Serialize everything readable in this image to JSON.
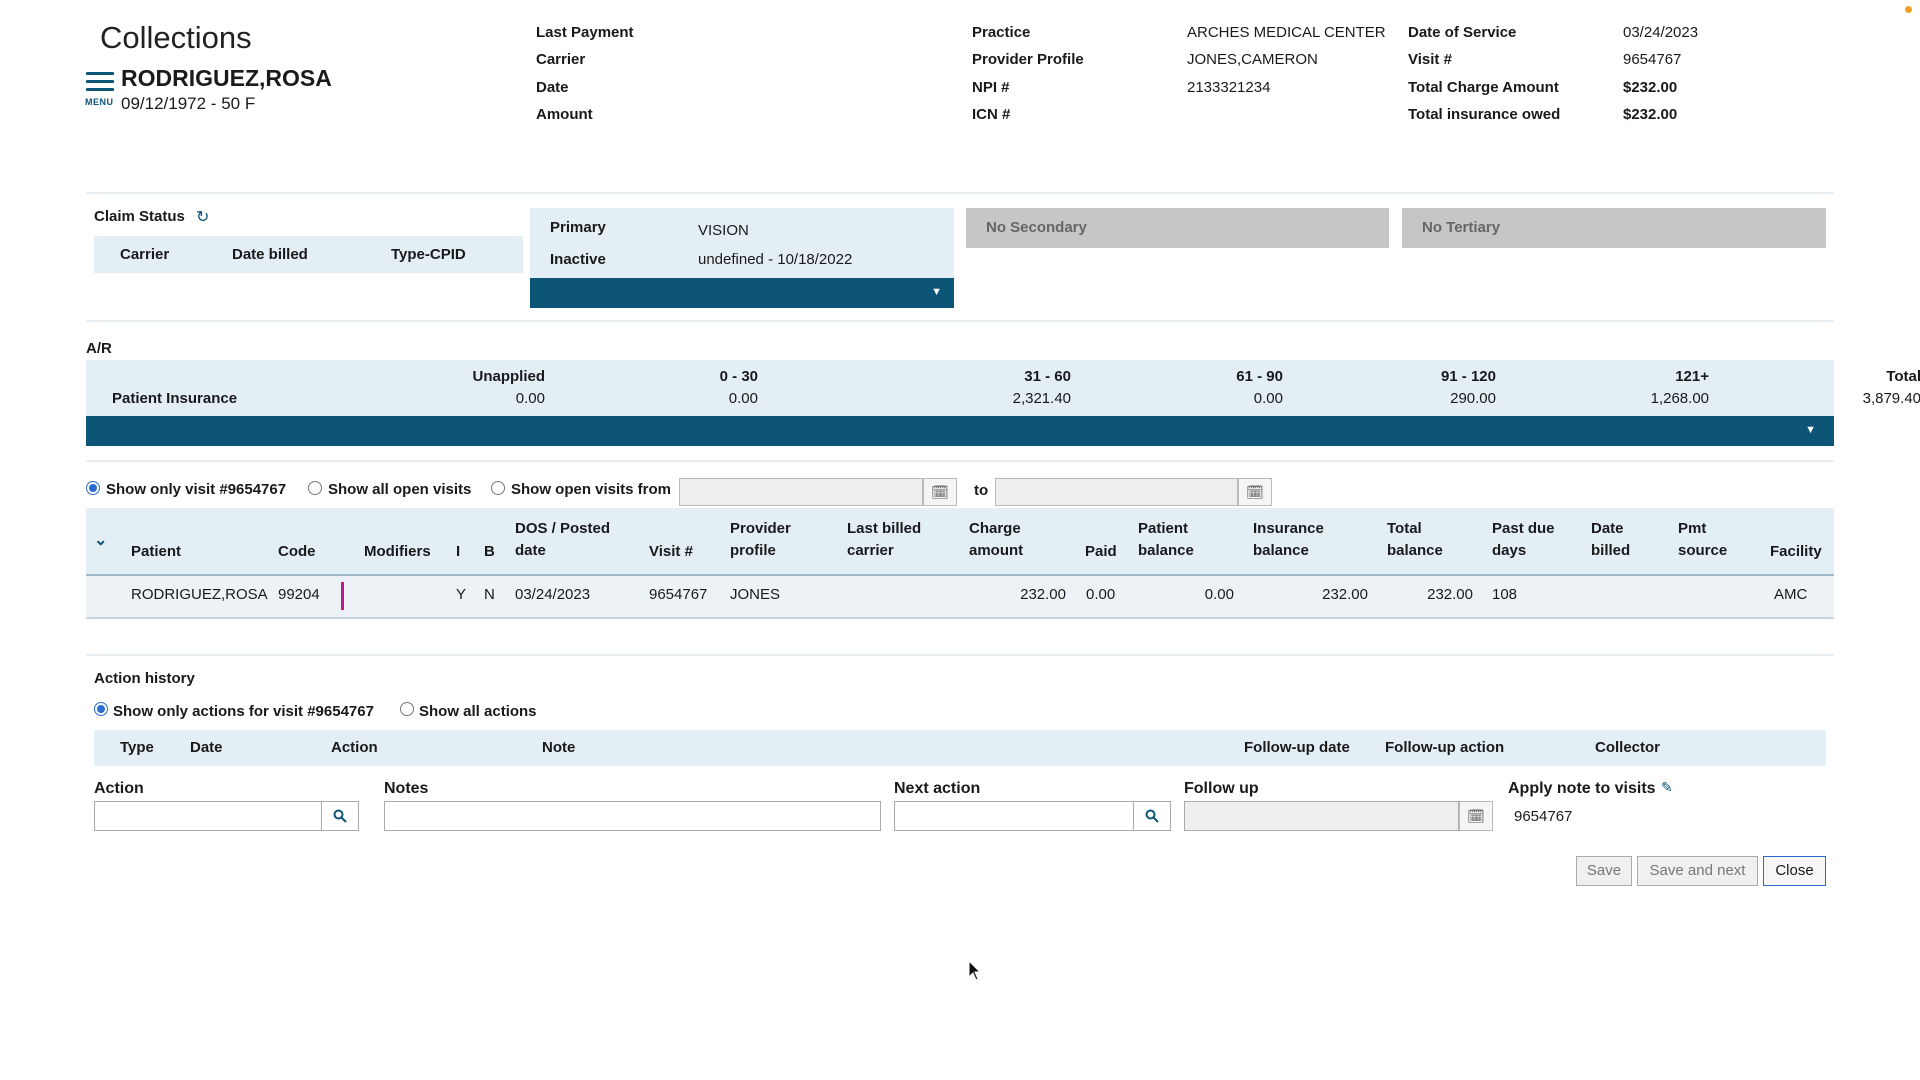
{
  "page": {
    "title": "Collections"
  },
  "menu": {
    "label": "MENU"
  },
  "patient": {
    "name": "RODRIGUEZ,ROSA",
    "dob_age": "09/12/1972 - 50 F"
  },
  "header": {
    "last_payment_label": "Last Payment",
    "carrier_label": "Carrier",
    "date_label": "Date",
    "amount_label": "Amount",
    "practice_label": "Practice",
    "practice_value": "ARCHES MEDICAL CENTER",
    "provider_profile_label": "Provider Profile",
    "provider_profile_value": "JONES,CAMERON",
    "npi_label": "NPI #",
    "npi_value": "2133321234",
    "icn_label": "ICN #",
    "dos_label": "Date of Service",
    "dos_value": "03/24/2023",
    "visit_label": "Visit #",
    "visit_value": "9654767",
    "total_charge_label": "Total Charge Amount",
    "total_charge_value": "$232.00",
    "total_ins_label": "Total insurance owed",
    "total_ins_value": "$232.00"
  },
  "claim_status": {
    "title": "Claim Status",
    "columns": [
      "Carrier",
      "Date billed",
      "Type-CPID"
    ],
    "primary_label": "Primary",
    "primary_value": "VISION",
    "inactive_label": "Inactive",
    "inactive_value": "undefined - 10/18/2022",
    "secondary": "No Secondary",
    "tertiary": "No Tertiary"
  },
  "ar": {
    "title": "A/R",
    "row_label": "Patient Insurance",
    "columns": [
      "Unapplied",
      "0 - 30",
      "31 - 60",
      "61 - 90",
      "91 - 120",
      "121+",
      "Total"
    ],
    "values": [
      "0.00",
      "0.00",
      "2,321.40",
      "0.00",
      "290.00",
      "1,268.00",
      "3,879.40"
    ]
  },
  "filters": {
    "opt1": "Show only visit #9654767",
    "opt2": "Show all open visits",
    "opt3": "Show open visits from",
    "to": "to"
  },
  "visits": {
    "headers": {
      "patient": "Patient",
      "code": "Code",
      "modifiers": "Modifiers",
      "i": "I",
      "b": "B",
      "dos1": "DOS / Posted",
      "dos2": "date",
      "visit": "Visit #",
      "prov1": "Provider",
      "prov2": "profile",
      "lbc1": "Last billed",
      "lbc2": "carrier",
      "ca1": "Charge",
      "ca2": "amount",
      "paid": "Paid",
      "pb1": "Patient",
      "pb2": "balance",
      "ib1": "Insurance",
      "ib2": "balance",
      "tb1": "Total",
      "tb2": "balance",
      "pd1": "Past due",
      "pd2": "days",
      "db1": "Date",
      "db2": "billed",
      "ps1": "Pmt",
      "ps2": "source",
      "facility": "Facility"
    },
    "row": {
      "patient": "RODRIGUEZ,ROSA",
      "code": "99204",
      "i": "Y",
      "b": "N",
      "dos": "03/24/2023",
      "visit": "9654767",
      "provider": "JONES",
      "charge": "232.00",
      "paid": "0.00",
      "pat_bal": "0.00",
      "ins_bal": "232.00",
      "total_bal": "232.00",
      "past_due": "108",
      "facility": "AMC"
    }
  },
  "action_history": {
    "title": "Action history",
    "opt1": "Show only actions for visit #9654767",
    "opt2": "Show all actions",
    "columns": {
      "type": "Type",
      "date": "Date",
      "action": "Action",
      "note": "Note",
      "fu_date": "Follow-up date",
      "fu_action": "Follow-up action",
      "collector": "Collector"
    }
  },
  "form": {
    "action_label": "Action",
    "notes_label": "Notes",
    "next_action_label": "Next action",
    "follow_up_label": "Follow up",
    "apply_label": "Apply note to visits",
    "apply_value": "9654767"
  },
  "buttons": {
    "save": "Save",
    "save_next": "Save and next",
    "close": "Close"
  }
}
